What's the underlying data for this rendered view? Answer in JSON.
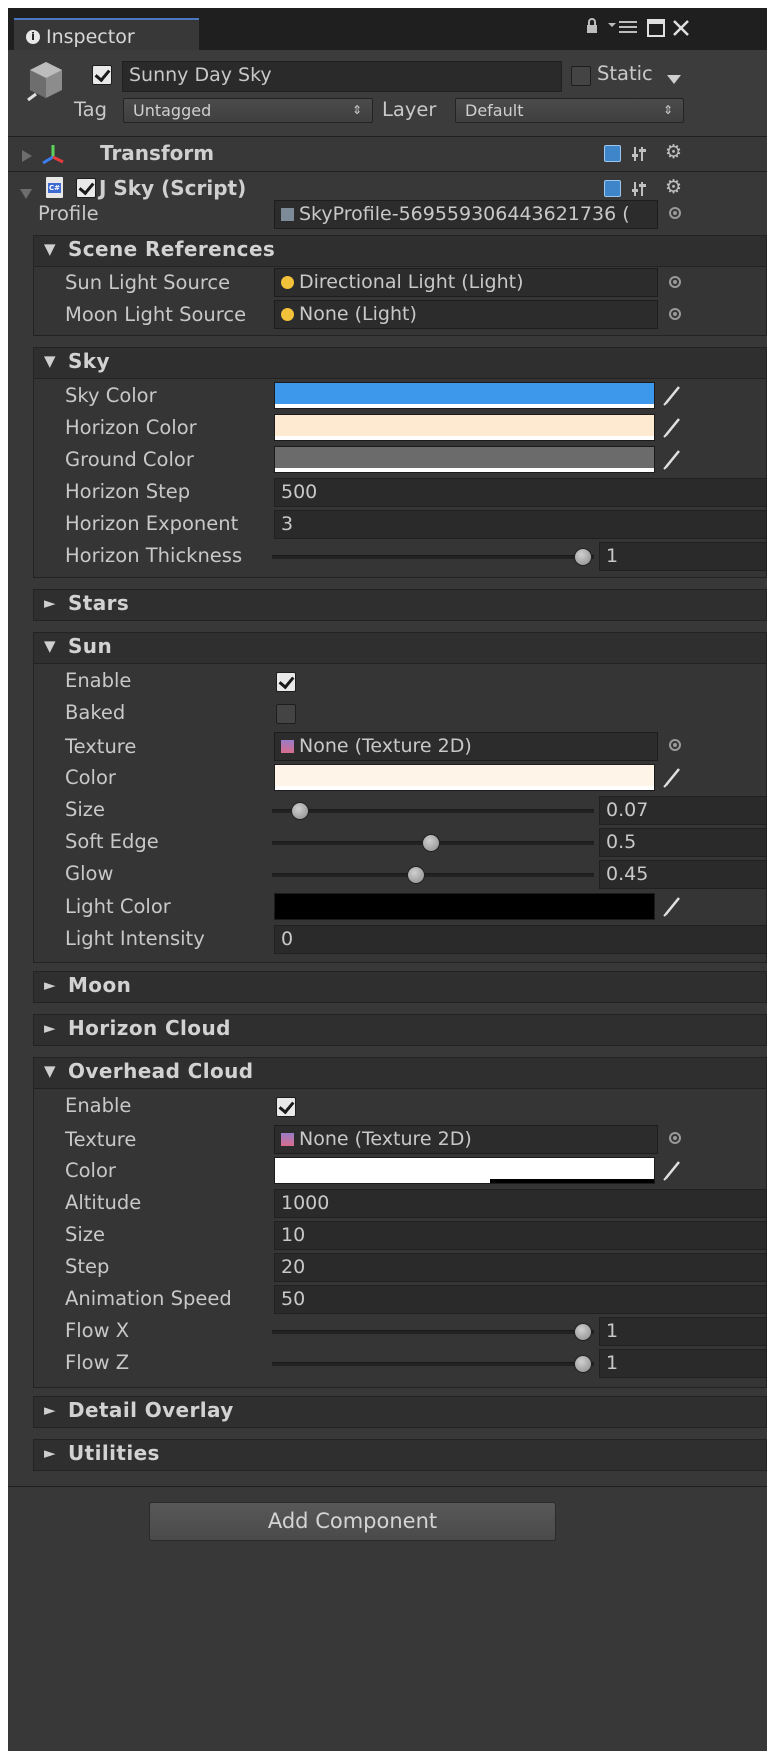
{
  "window": {
    "tab_label": "Inspector",
    "tab_icon": "info-icon",
    "controls": [
      "lock-icon",
      "menu-icon",
      "maximize-icon",
      "close-icon"
    ]
  },
  "gameobject": {
    "enabled": true,
    "name": "Sunny Day Sky",
    "static_label": "Static",
    "static_checked": false,
    "tag_label": "Tag",
    "tag_value": "Untagged",
    "layer_label": "Layer",
    "layer_value": "Default"
  },
  "components": {
    "transform": {
      "title": "Transform",
      "expanded": false
    },
    "sky_script": {
      "title": "J Sky (Script)",
      "enabled": true,
      "expanded": true
    }
  },
  "profile": {
    "label": "Profile",
    "value": "SkyProfile-569559306443621736 ("
  },
  "scene_references": {
    "title": "Scene References",
    "sun_label": "Sun Light Source",
    "sun_value": "Directional Light (Light)",
    "moon_label": "Moon Light Source",
    "moon_value": "None (Light)"
  },
  "sky": {
    "title": "Sky",
    "sky_color_label": "Sky Color",
    "sky_color": "#3d97eb",
    "horizon_color_label": "Horizon Color",
    "horizon_color": "#fdead1",
    "ground_color_label": "Ground Color",
    "ground_color": "#6b6b6b",
    "horizon_step_label": "Horizon Step",
    "horizon_step": "500",
    "horizon_exponent_label": "Horizon Exponent",
    "horizon_exponent": "3",
    "horizon_thickness_label": "Horizon Thickness",
    "horizon_thickness": "1"
  },
  "stars": {
    "title": "Stars"
  },
  "sun": {
    "title": "Sun",
    "enable_label": "Enable",
    "enable": true,
    "baked_label": "Baked",
    "baked": false,
    "texture_label": "Texture",
    "texture_value": "None (Texture 2D)",
    "color_label": "Color",
    "color": "#fff4e8",
    "size_label": "Size",
    "size": "0.07",
    "soft_edge_label": "Soft Edge",
    "soft_edge": "0.5",
    "glow_label": "Glow",
    "glow": "0.45",
    "light_color_label": "Light Color",
    "light_color": "#000000",
    "light_intensity_label": "Light Intensity",
    "light_intensity": "0"
  },
  "moon": {
    "title": "Moon"
  },
  "horizon_cloud": {
    "title": "Horizon Cloud"
  },
  "overhead_cloud": {
    "title": "Overhead Cloud",
    "enable_label": "Enable",
    "enable": true,
    "texture_label": "Texture",
    "texture_value": "None (Texture 2D)",
    "color_label": "Color",
    "color": "#ffffff",
    "altitude_label": "Altitude",
    "altitude": "1000",
    "size_label": "Size",
    "size": "10",
    "step_label": "Step",
    "step": "20",
    "animation_speed_label": "Animation Speed",
    "animation_speed": "50",
    "flow_x_label": "Flow X",
    "flow_x": "1",
    "flow_z_label": "Flow Z",
    "flow_z": "1"
  },
  "detail_overlay": {
    "title": "Detail Overlay"
  },
  "utilities": {
    "title": "Utilities"
  },
  "add_component_label": "Add Component",
  "arrows": {
    "expanded": "▼",
    "collapsed": "►"
  }
}
